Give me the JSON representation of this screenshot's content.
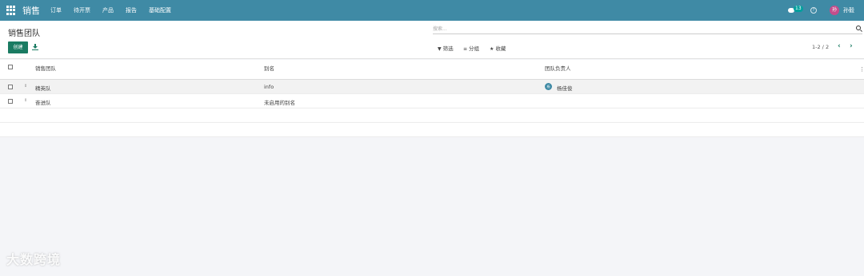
{
  "nav": {
    "brand": "销售",
    "menu": [
      "订单",
      "待开票",
      "产品",
      "报告",
      "基础配置"
    ],
    "chat_count": "13",
    "user_avatar": "孙",
    "user_name": "孙毅"
  },
  "panel": {
    "title": "销售团队",
    "search_placeholder": "搜索...",
    "create_label": "创建",
    "filter_label": "筛选",
    "group_label": "分组",
    "favorite_label": "收藏",
    "pager": "1-2 / 2"
  },
  "table": {
    "headers": [
      "销售团队",
      "别名",
      "团队负责人"
    ],
    "rows": [
      {
        "team": "精英队",
        "alias": "info",
        "leader_avatar": "杨",
        "leader": "杨佳俊"
      },
      {
        "team": "奋进队",
        "alias": "未启用的别名",
        "leader_avatar": "",
        "leader": ""
      }
    ]
  },
  "watermark": "大数跨境"
}
